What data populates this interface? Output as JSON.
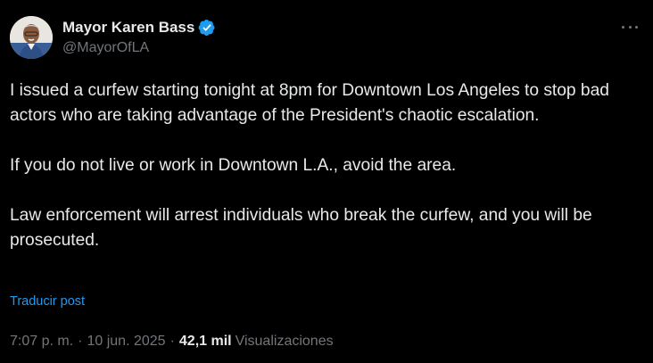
{
  "post": {
    "author": {
      "display_name": "Mayor Karen Bass",
      "handle": "@MayorOfLA",
      "verified": true,
      "avatar": "profile-photo"
    },
    "paragraphs": [
      "I issued a curfew starting tonight at 8pm for Downtown Los Angeles to stop bad actors who are taking advantage of the President's chaotic escalation.",
      "If you do not live or work in Downtown L.A., avoid the area.",
      "Law enforcement will arrest individuals who break the curfew, and you will be prosecuted."
    ],
    "translate_label": "Traducir post",
    "time": "7:07 p. m.",
    "date": "10 jun. 2025",
    "separator": "·",
    "views_count": "42,1 mil",
    "views_label": "Visualizaciones",
    "more_icon": "more-horizontal-icon"
  },
  "colors": {
    "background": "#000000",
    "text_primary": "#e7e9ea",
    "text_secondary": "#71767b",
    "link": "#1d9bf0",
    "verified_badge": "#1d9bf0"
  }
}
